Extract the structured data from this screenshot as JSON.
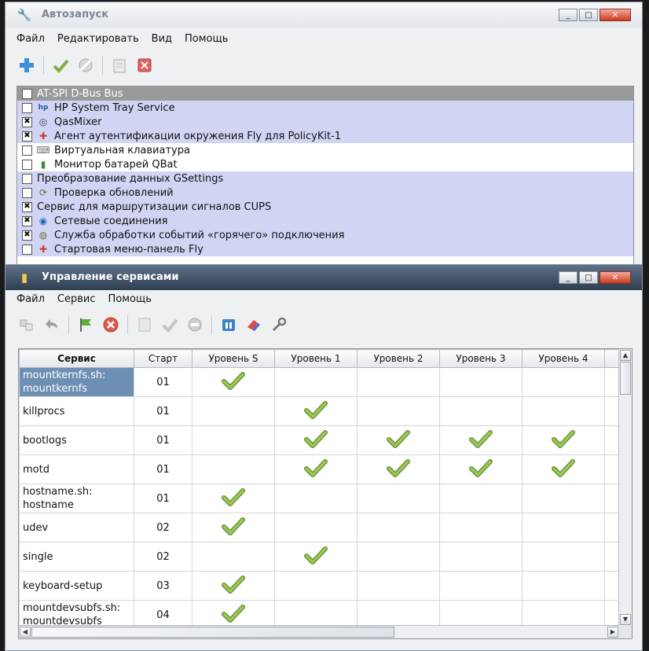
{
  "autostart": {
    "title": "Автозапуск",
    "window_buttons": {
      "minimize": "_",
      "maximize": "□",
      "close": "✕"
    },
    "menu": [
      "Файл",
      "Редактировать",
      "Вид",
      "Помощь"
    ],
    "toolbar": [
      {
        "name": "add-icon"
      },
      {
        "name": "enable-icon"
      },
      {
        "name": "disable-icon"
      },
      {
        "name": "edit-icon"
      },
      {
        "name": "delete-icon"
      }
    ],
    "items": [
      {
        "label": "AT-SPI D-Bus Bus",
        "checked": false,
        "icon": "",
        "style": "hdr"
      },
      {
        "label": "HP System Tray Service",
        "checked": false,
        "icon": "hp-icon",
        "style": "sel"
      },
      {
        "label": "QasMixer",
        "checked": true,
        "icon": "mixer-icon",
        "style": "sel"
      },
      {
        "label": "Агент аутентификации окружения Fly для PolicyKit-1",
        "checked": true,
        "icon": "key-icon",
        "style": "sel"
      },
      {
        "label": "Виртуальная клавиатура",
        "checked": false,
        "icon": "keyboard-icon",
        "style": "white"
      },
      {
        "label": "Монитор батарей QBat",
        "checked": false,
        "icon": "battery-icon",
        "style": "white"
      },
      {
        "label": "Преобразование данных GSettings",
        "checked": false,
        "icon": "",
        "style": "sel"
      },
      {
        "label": "Проверка обновлений",
        "checked": false,
        "icon": "update-icon",
        "style": "sel"
      },
      {
        "label": "Сервис для маршрутизации сигналов CUPS",
        "checked": true,
        "icon": "",
        "style": "sel"
      },
      {
        "label": "Сетевые соединения",
        "checked": true,
        "icon": "network-icon",
        "style": "sel"
      },
      {
        "label": "Служба обработки событий «горячего» подключения",
        "checked": true,
        "icon": "hotplug-icon",
        "style": "sel"
      },
      {
        "label": "Стартовая меню-панель Fly",
        "checked": false,
        "icon": "fly-panel-icon",
        "style": "sel"
      }
    ]
  },
  "services": {
    "title": "Управление сервисами",
    "window_buttons": {
      "minimize": "_",
      "maximize": "□",
      "close": "✕"
    },
    "menu": [
      "Файл",
      "Сервис",
      "Помощь"
    ],
    "columns": [
      "Сервис",
      "Старт",
      "Уровень S",
      "Уровень 1",
      "Уровень 2",
      "Уровень 3",
      "Уровень 4"
    ],
    "rows": [
      {
        "name": "mountkernfs.sh:\nmountkernfs",
        "start": "01",
        "levels": [
          true,
          false,
          false,
          false,
          false
        ],
        "selected": true
      },
      {
        "name": "killprocs",
        "start": "01",
        "levels": [
          false,
          true,
          false,
          false,
          false
        ]
      },
      {
        "name": "bootlogs",
        "start": "01",
        "levels": [
          false,
          true,
          true,
          true,
          true
        ]
      },
      {
        "name": "motd",
        "start": "01",
        "levels": [
          false,
          true,
          true,
          true,
          true
        ]
      },
      {
        "name": "hostname.sh:\nhostname",
        "start": "01",
        "levels": [
          true,
          false,
          false,
          false,
          false
        ]
      },
      {
        "name": "udev",
        "start": "02",
        "levels": [
          true,
          false,
          false,
          false,
          false
        ]
      },
      {
        "name": "single",
        "start": "02",
        "levels": [
          false,
          true,
          false,
          false,
          false
        ]
      },
      {
        "name": "keyboard-setup",
        "start": "03",
        "levels": [
          true,
          false,
          false,
          false,
          false
        ]
      },
      {
        "name": "mountdevsubfs.sh:\nmountdevsubfs",
        "start": "04",
        "levels": [
          true,
          false,
          false,
          false,
          false
        ]
      }
    ]
  },
  "colors": {
    "check_green": "#8ab04a",
    "selection": "#d2d4f4",
    "row_selected": "#6e8fb4"
  }
}
